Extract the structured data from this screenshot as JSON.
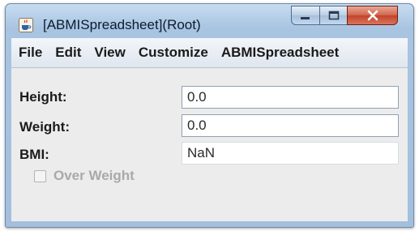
{
  "window": {
    "title": "[ABMISpreadsheet](Root)",
    "icon": "java-coffee-cup-icon",
    "controls": [
      "minimize-icon",
      "maximize-icon",
      "close-icon"
    ]
  },
  "menu": {
    "items": [
      {
        "label": "File"
      },
      {
        "label": "Edit"
      },
      {
        "label": "View"
      },
      {
        "label": "Customize"
      },
      {
        "label": "ABMISpreadsheet"
      }
    ]
  },
  "form": {
    "height": {
      "label": "Height:",
      "value": "0.0"
    },
    "weight": {
      "label": "Weight:",
      "value": "0.0"
    },
    "bmi": {
      "label": "BMI:",
      "value": "NaN"
    },
    "overweight": {
      "label": "Over Weight",
      "checked": false,
      "enabled": false
    }
  },
  "colors": {
    "window_frame": "#a9c4e1",
    "close_button": "#c2432a",
    "panel_background": "#ececec",
    "disabled_text": "#a9a9a9"
  }
}
